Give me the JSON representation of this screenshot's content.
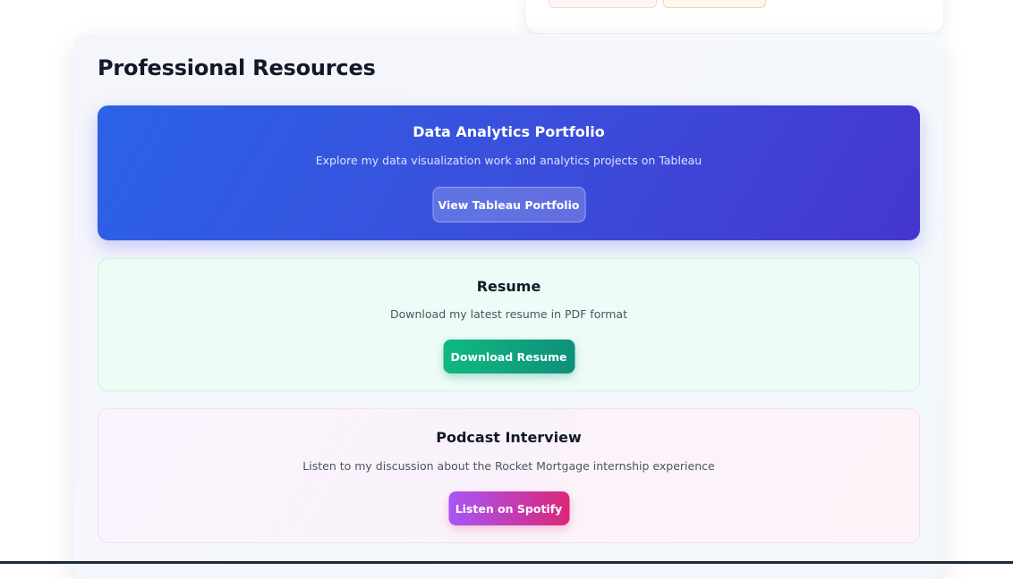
{
  "section": {
    "title": "Professional Resources"
  },
  "cards": {
    "tableau": {
      "title": "Data Analytics Portfolio",
      "description": "Explore my data visualization work and analytics projects on Tableau",
      "button_label": "View Tableau Portfolio"
    },
    "resume": {
      "title": "Resume",
      "description": "Download my latest resume in PDF format",
      "button_label": "Download Resume"
    },
    "podcast": {
      "title": "Podcast Interview",
      "description": "Listen to my discussion about the Rocket Mortgage internship experience",
      "button_label": "Listen on Spotify"
    }
  },
  "colors": {
    "tableau_gradient_start": "#2b62e6",
    "tableau_gradient_end": "#4536cf",
    "resume_button_start": "#10b981",
    "resume_button_end": "#0f8f7c",
    "podcast_button_start": "#a855f7",
    "podcast_button_end": "#db2777"
  }
}
